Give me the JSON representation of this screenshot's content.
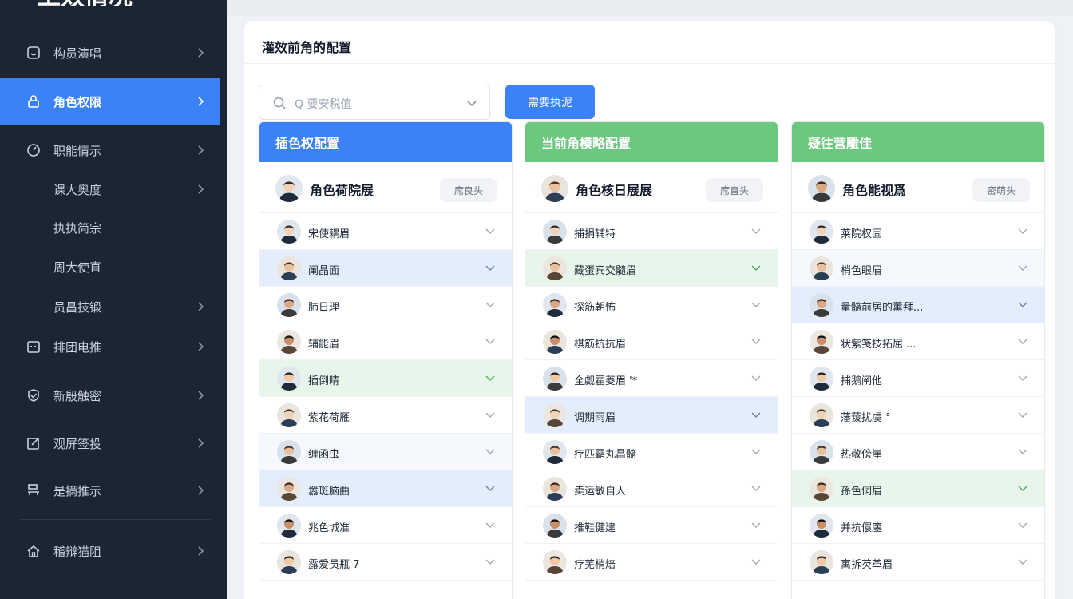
{
  "sidebar": {
    "brand": "工效情况",
    "items": [
      {
        "label": "构员演唱",
        "icon": "dashboard-icon",
        "chevron": true,
        "active": false
      },
      {
        "label": "角色权限",
        "icon": "lock-icon",
        "chevron": true,
        "active": true
      },
      {
        "label": "职能情示",
        "icon": "gauge-icon",
        "chevron": true,
        "active": false
      },
      {
        "label": "课大奥度",
        "icon": "",
        "chevron": true,
        "active": false,
        "sub": true
      },
      {
        "label": "执执简宗",
        "icon": "",
        "chevron": false,
        "active": false,
        "sub": true
      },
      {
        "label": "周大使直",
        "icon": "",
        "chevron": false,
        "active": false,
        "sub": true
      },
      {
        "label": "员昌技锻",
        "icon": "",
        "chevron": true,
        "active": false,
        "sub": true
      },
      {
        "label": "排团电推",
        "icon": "calendar-icon",
        "chevron": true,
        "active": false
      },
      {
        "label": "新殷触密",
        "icon": "shield-check-icon",
        "chevron": true,
        "active": false
      },
      {
        "label": "观屏签投",
        "icon": "edit-icon",
        "chevron": true,
        "active": false
      },
      {
        "label": "是摘推示",
        "icon": "org-chart-icon",
        "chevron": true,
        "active": false
      },
      {
        "label": "稽辩猫阻",
        "icon": "home-icon",
        "chevron": true,
        "active": false
      }
    ]
  },
  "main": {
    "panel_title": "灌效前角的配置",
    "search": {
      "placeholder": "Q 要安税值"
    },
    "primary_button": "需要执泥"
  },
  "columns": [
    {
      "header": "插色权配置",
      "header_color": "#3b82f6",
      "lead": {
        "name": "角色荷院展",
        "chip": "席良头"
      },
      "rows": [
        {
          "name": "宋使耦眉",
          "state": "none"
        },
        {
          "name": "阐晶面",
          "state": "blue"
        },
        {
          "name": "肺日理",
          "state": "none"
        },
        {
          "name": "辅能眉",
          "state": "none"
        },
        {
          "name": "插倒睛",
          "state": "green"
        },
        {
          "name": "紫花荷雁",
          "state": "none"
        },
        {
          "name": "缠函虫",
          "state": "light"
        },
        {
          "name": "嚣斑脑曲",
          "state": "blue"
        },
        {
          "name": "兆色城准",
          "state": "none"
        },
        {
          "name": "露爱员瓶 7",
          "state": "none"
        }
      ]
    },
    {
      "header": "当前角模略配置",
      "header_color": "#6cc77f",
      "lead": {
        "name": "角色核日展展",
        "chip": "席直头"
      },
      "rows": [
        {
          "name": "捕捐辅特",
          "state": "none"
        },
        {
          "name": "藏蛋宾交髓眉",
          "state": "green"
        },
        {
          "name": "探筋朝怖",
          "state": "none"
        },
        {
          "name": "棋筋抗抗眉",
          "state": "none"
        },
        {
          "name": "全觑霍菱眉 '*",
          "state": "none"
        },
        {
          "name": "调期雨眉",
          "state": "blue"
        },
        {
          "name": "疗匹霸丸昌髓",
          "state": "none"
        },
        {
          "name": "卖运敏自人",
          "state": "none"
        },
        {
          "name": "推鞋健建",
          "state": "none"
        },
        {
          "name": "疗芜梢焙",
          "state": "none"
        }
      ]
    },
    {
      "header": "疑往营雕佳",
      "header_color": "#6cc77f",
      "lead": {
        "name": "角色能视爲",
        "chip": "密萌头"
      },
      "rows": [
        {
          "name": "莱院权固",
          "state": "none"
        },
        {
          "name": "梢色眼眉",
          "state": "light"
        },
        {
          "name": "量髓前居的薰拜...",
          "state": "blue"
        },
        {
          "name": "状紫笺技拓屈 ...",
          "state": "none"
        },
        {
          "name": "捕鹅阐他",
          "state": "none"
        },
        {
          "name": "藩菝扰虞 °",
          "state": "none"
        },
        {
          "name": "热敬傍崖",
          "state": "none"
        },
        {
          "name": "孫色侗眉",
          "state": "green"
        },
        {
          "name": "并抗儇廛",
          "state": "none"
        },
        {
          "name": "寓拆芡革眉",
          "state": "none"
        }
      ]
    }
  ],
  "colors": {
    "sidebar_bg": "#1c2534",
    "accent_blue": "#3b82f6",
    "accent_green": "#6cc77f",
    "row_blue": "#e3edfb",
    "row_green": "#e8f5ea"
  }
}
